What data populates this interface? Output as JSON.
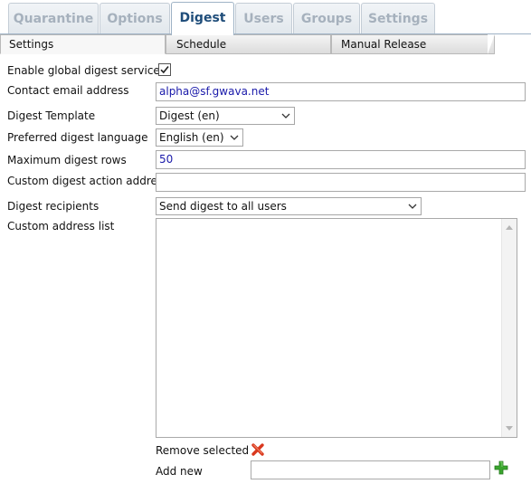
{
  "main_tabs": [
    "Quarantine",
    "Options",
    "Digest",
    "Users",
    "Groups",
    "Settings"
  ],
  "active_main_tab": "Digest",
  "sub_tabs": [
    "Settings",
    "Schedule",
    "Manual Release"
  ],
  "form": {
    "enable_label": "Enable global digest services",
    "enable_checked": true,
    "contact_label": "Contact email address",
    "contact_value": "alpha@sf.gwava.net",
    "template_label": "Digest Template",
    "template_value": "Digest (en)",
    "language_label": "Preferred digest language",
    "language_value": "English (en)",
    "max_rows_label": "Maximum digest rows",
    "max_rows_value": "50",
    "custom_action_label": "Custom digest action address",
    "custom_action_value": "",
    "recipients_label": "Digest recipients",
    "recipients_value": "Send digest to all users",
    "address_list_label": "Custom address list",
    "remove_selected_label": "Remove selected",
    "add_new_label": "Add new",
    "add_new_value": ""
  },
  "icons": {
    "remove": "red-x-icon",
    "add": "green-plus-icon"
  },
  "colors": {
    "active_tab_text": "#1f4d7a",
    "inactive_tab_text": "#a6b1bd",
    "input_value_text": "#1a1aaa",
    "remove_icon": "#d9381e",
    "add_icon": "#3aa52e"
  }
}
